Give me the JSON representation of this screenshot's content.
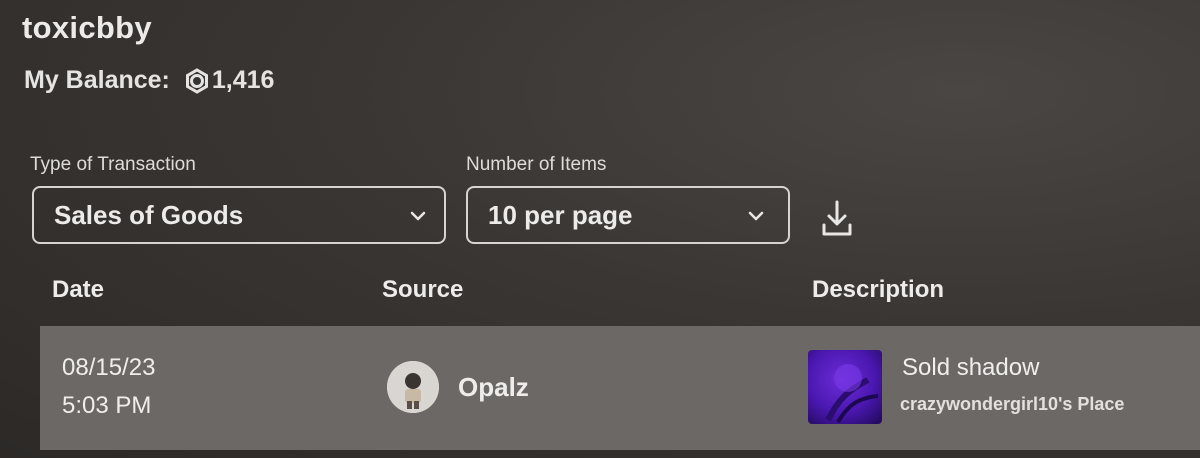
{
  "header": {
    "username": "toxicbby",
    "balance_label": "My Balance:",
    "balance_value": "1,416",
    "currency_icon": "robux-icon"
  },
  "filters": {
    "transaction_type_label": "Type of Transaction",
    "transaction_type_value": "Sales of Goods",
    "items_label": "Number of Items",
    "items_value": "10 per page"
  },
  "table": {
    "columns": [
      "Date",
      "Source",
      "Description"
    ],
    "rows": [
      {
        "date": "08/15/23",
        "time": "5:03 PM",
        "source": "Opalz",
        "description": "Sold shadow",
        "place": "crazywondergirl10's Place"
      }
    ]
  },
  "colors": {
    "row_background": "#6b6866",
    "border": "#d6d3d0",
    "thumbnail": "#4a17b0"
  }
}
